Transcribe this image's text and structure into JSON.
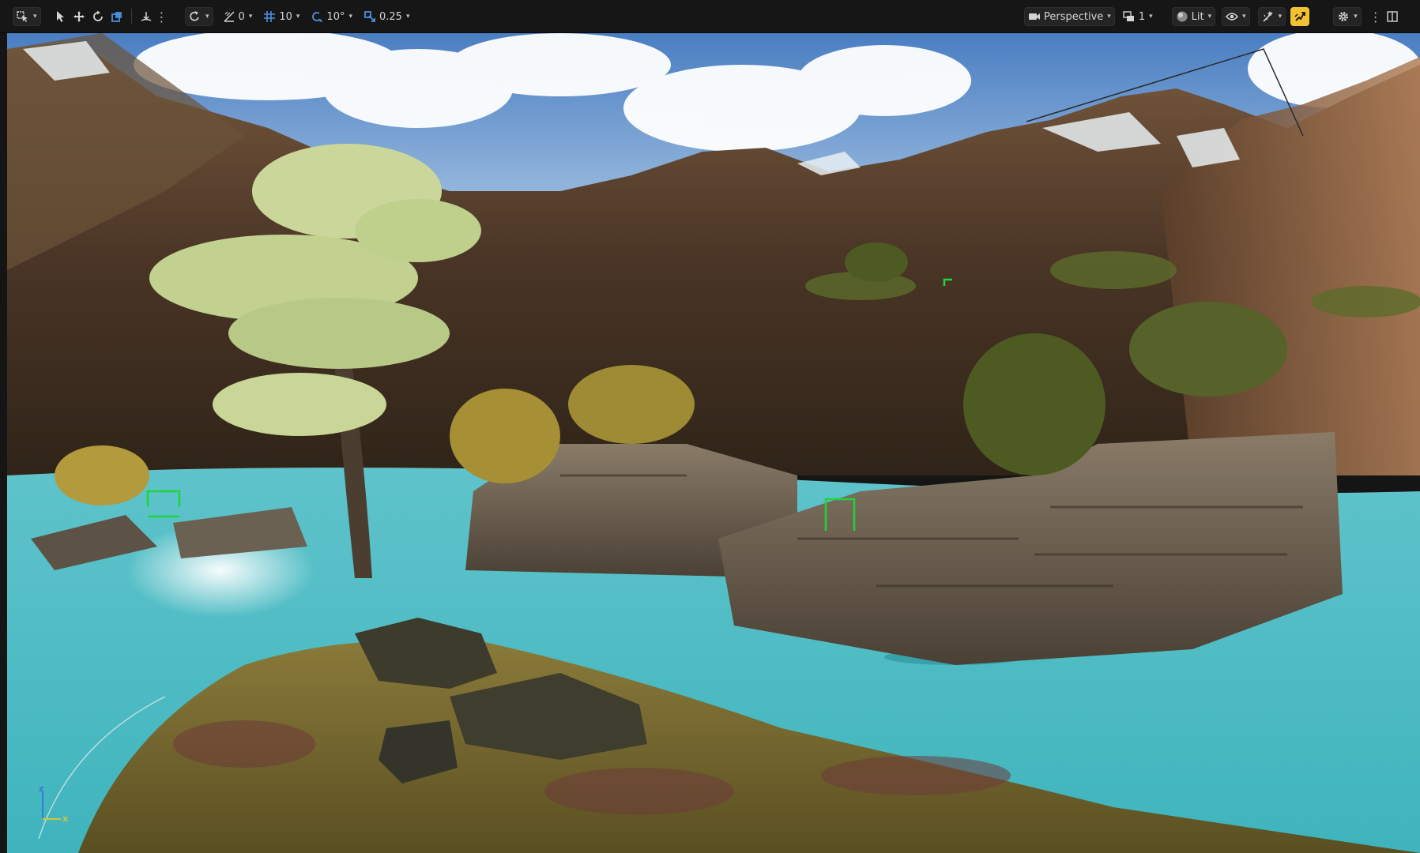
{
  "toolbar": {
    "transform": {
      "select_mode_icon": "select-mode-icon",
      "select_icon": "arrow-select-icon",
      "translate_icon": "move-icon",
      "rotate_icon": "rotate-icon",
      "scale_icon": "scale-icon",
      "surface_snap_icon": "surface-snap-icon"
    },
    "snapping": {
      "world_local_icon": "world-local-icon",
      "angle_snap_value": "0",
      "grid_snap_value": "10",
      "rotation_snap_value": "10°",
      "scale_snap_value": "0.25"
    },
    "view": {
      "camera_label": "Perspective",
      "view_count": "1",
      "lit_label": "Lit"
    },
    "accent_color": "#f1c232",
    "snap_icon_color": "#4a90e2"
  },
  "viewport": {
    "axis": {
      "z": "z",
      "x": "x"
    }
  }
}
